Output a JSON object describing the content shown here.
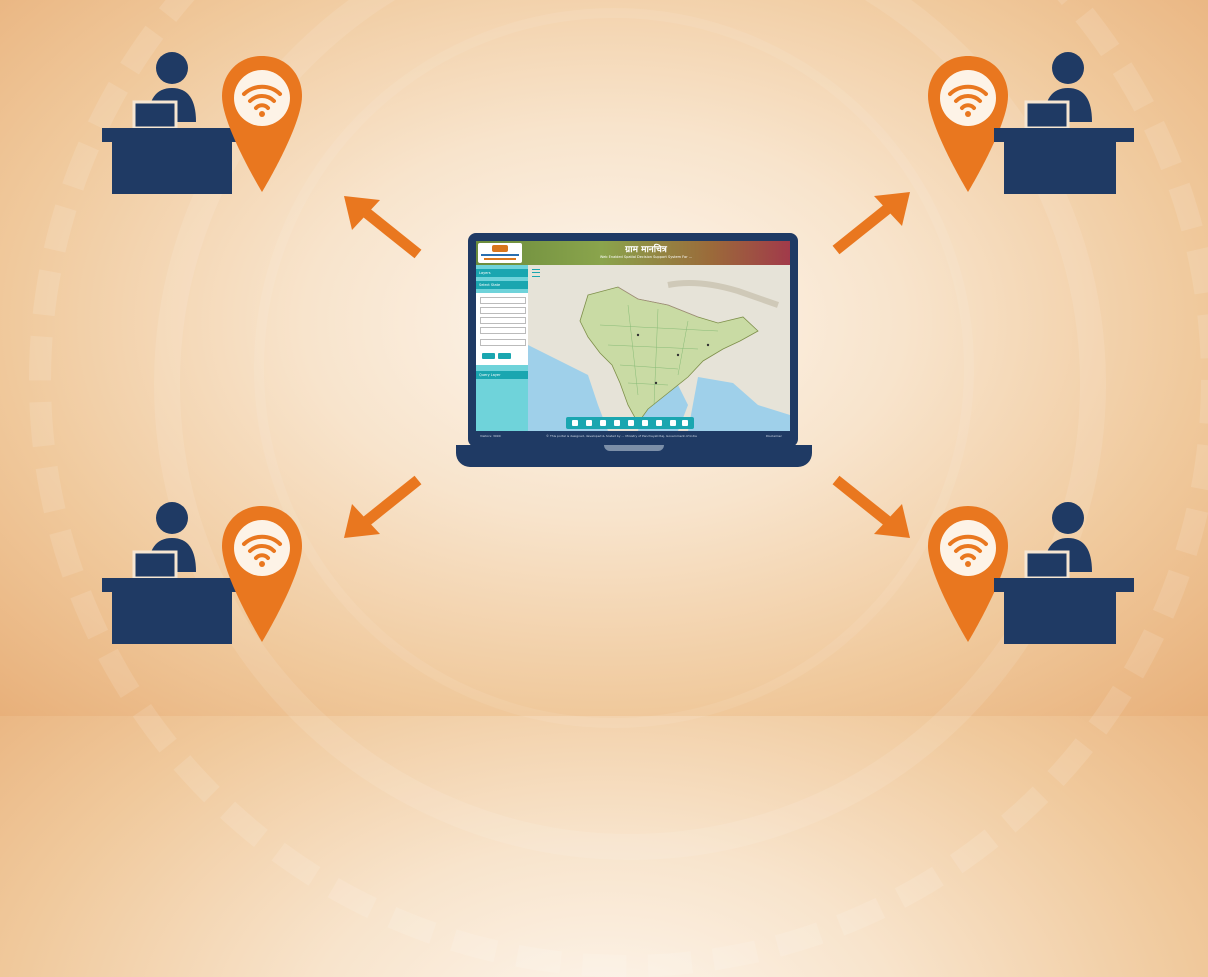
{
  "colors": {
    "navy": "#1f3a64",
    "orange": "#e9771f",
    "teal": "#1aa6b0",
    "background": "#f8e4cc"
  },
  "icons": {
    "person": "person-icon",
    "desk": "desk-icon",
    "computer": "computer-monitor-icon",
    "location_pin": "location-pin-icon",
    "wifi": "wifi-icon",
    "arrow": "arrow-icon",
    "laptop": "laptop-icon"
  },
  "stations": [
    {
      "id": "top-left"
    },
    {
      "id": "top-right"
    },
    {
      "id": "bottom-left"
    },
    {
      "id": "bottom-right"
    }
  ],
  "laptop_screen": {
    "title": "ग्राम मानचित्र",
    "subtitle": "Web Enabled Spatial Decision Support System For ...",
    "sidebar_sections": [
      "Layers",
      "Select State",
      "Query Layer"
    ],
    "footer_left": "Visitors: 3090",
    "footer_center": "© This portal is designed, developed & hosted by ... Ministry of Panchayati Raj, Government of India",
    "footer_right": "Disclaimer"
  }
}
